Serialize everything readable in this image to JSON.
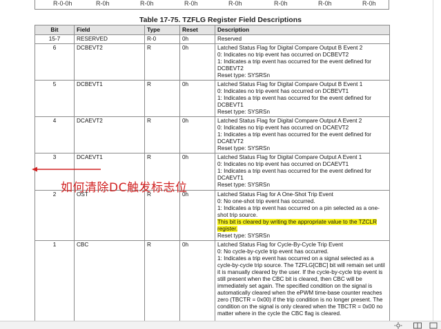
{
  "top_row": {
    "cells": [
      "R-0-0h",
      "R-0h",
      "R-0h",
      "R-0h",
      "R-0h",
      "R-0h",
      "R-0h",
      "R-0h"
    ]
  },
  "table": {
    "title": "Table 17-75. TZFLG Register Field Descriptions",
    "headers": [
      "Bit",
      "Field",
      "Type",
      "Reset",
      "Description"
    ],
    "rows": [
      {
        "bit": "15-7",
        "field": "RESERVED",
        "type": "R-0",
        "reset": "0h",
        "desc": [
          "Reserved"
        ]
      },
      {
        "bit": "6",
        "field": "DCBEVT2",
        "type": "R",
        "reset": "0h",
        "desc": [
          "Latched Status Flag for Digital Compare Output B Event 2",
          "0: Indicates no trip event has occurred on DCBEVT2",
          "1: Indicates a trip event has occurred for the event defined for DCBEVT2",
          "Reset type: SYSRSn"
        ]
      },
      {
        "bit": "5",
        "field": "DCBEVT1",
        "type": "R",
        "reset": "0h",
        "desc": [
          "Latched Status Flag for Digital Compare Output B Event 1",
          "0: Indicates no trip event has occurred on DCBEVT1",
          "1: Indicates a trip event has occurred for the event defined for DCBEVT1",
          "Reset type: SYSRSn"
        ]
      },
      {
        "bit": "4",
        "field": "DCAEVT2",
        "type": "R",
        "reset": "0h",
        "desc": [
          "Latched Status Flag for Digital Compare Output A Event 2",
          "0: Indicates no trip event has occurred on DCAEVT2",
          "1: Indicates a trip event has occurred for the event defined for DCAEVT2",
          "Reset type: SYSRSn"
        ]
      },
      {
        "bit": "3",
        "field": "DCAEVT1",
        "type": "R",
        "reset": "0h",
        "desc": [
          "Latched Status Flag for Digital Compare Output A Event 1",
          "0: Indicates no trip event has occurred on DCAEVT1",
          "1: Indicates a trip event has occurred for the event defined for DCAEVT1",
          "Reset type: SYSRSn"
        ]
      },
      {
        "bit": "2",
        "field": "OST",
        "type": "R",
        "reset": "0h",
        "desc": [
          "Latched Status Flag for A One-Shot Trip Event",
          "0: No one-shot trip event has occurred.",
          "1: Indicates a trip event has occurred on a pin selected as a one-shot trip source."
        ],
        "highlight": "This bit is cleared by writing the appropriate value to the TZCLR register.",
        "desc_after": "Reset type: SYSRSn"
      },
      {
        "bit": "1",
        "field": "CBC",
        "type": "R",
        "reset": "0h",
        "desc": [
          "Latched Status Flag for Cycle-By-Cycle Trip Event",
          "0: No cycle-by-cycle trip event has occurred.",
          "1: Indicates a trip event has occurred on a signal selected as a cycle-by-cycle trip source. The TZFLG[CBC] bit will remain set until it is manually cleared by the user. If the cycle-by-cycle trip event is still present when the CBC bit is cleared, then CBC will be immediately set again. The specified condition on the signal is automatically cleared when the ePWM time-base counter reaches zero (TBCTR = 0x00) if the trip condition is no longer present. The condition on the signal is only cleared when the TBCTR = 0x00 no matter where in the cycle the CBC flag is cleared."
        ]
      }
    ]
  },
  "annotation": {
    "text": "如何清除DC触发标志位",
    "color": "#d12222"
  },
  "colors": {
    "header_bg": "#e4e4e4",
    "highlight": "#f7f21c",
    "annotation": "#d12222"
  },
  "status_bar": {
    "icons": [
      "sun-icon",
      "two-page-view-icon",
      "single-page-view-icon"
    ]
  }
}
